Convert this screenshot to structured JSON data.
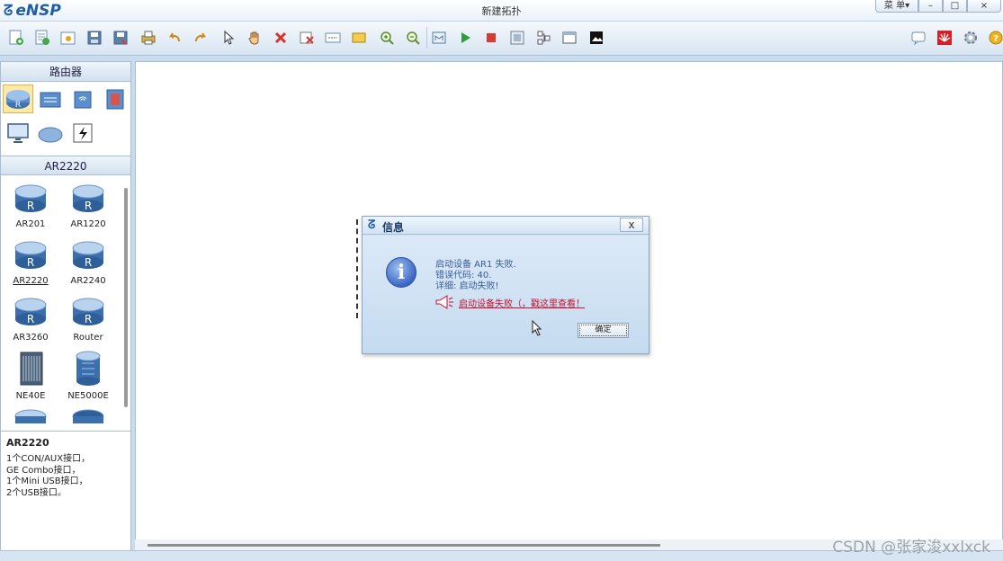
{
  "titlebar": {
    "app_name": "eNSP",
    "window_title": "新建拓扑",
    "menu_label": "菜 单▾",
    "minimize": "–",
    "maximize": "□",
    "close": "×"
  },
  "toolbar": {
    "icons": [
      "new-topology-icon",
      "new-exam-icon",
      "open-icon",
      "save-icon",
      "save-as-icon",
      "print-icon",
      "undo-icon",
      "redo-icon",
      "select-icon",
      "pan-hand-icon",
      "delete-icon",
      "delete-link-icon",
      "text-icon",
      "rectangle-icon",
      "zoom-in-icon",
      "zoom-out-icon",
      "custom-view-icon",
      "start-device-icon",
      "stop-device-icon",
      "capture-icon",
      "topology-icon",
      "palette-icon",
      "screenshot-icon"
    ],
    "right_icons": [
      "chat-icon",
      "huawei-logo-icon",
      "settings-icon",
      "help-icon"
    ]
  },
  "left_panel": {
    "section_router": "路由器",
    "section_model": "AR2220",
    "devices": [
      {
        "label": "AR201"
      },
      {
        "label": "AR1220"
      },
      {
        "label": "AR2220"
      },
      {
        "label": "AR2240"
      },
      {
        "label": "AR3260"
      },
      {
        "label": "Router"
      },
      {
        "label": "NE40E"
      },
      {
        "label": "NE5000E"
      }
    ],
    "description": {
      "title": "AR2220",
      "lines": [
        "1个CON/AUX接口，",
        "GE Combo接口，",
        "1个Mini USB接口，",
        "2个USB接口。"
      ]
    }
  },
  "dialog": {
    "title": "信息",
    "close": "x",
    "line1": "启动设备 AR1 失败.",
    "line2": "错误代码: 40.",
    "line3": "详细: 启动失败!",
    "link": "启动设备失败（，戳这里查看！",
    "ok": "确定"
  },
  "watermark": "CSDN @张家浚xxlxck",
  "colors": {
    "accent": "#1f5fa8",
    "link_red": "#c8102e",
    "dialog_bg": "#cfe2f4"
  }
}
